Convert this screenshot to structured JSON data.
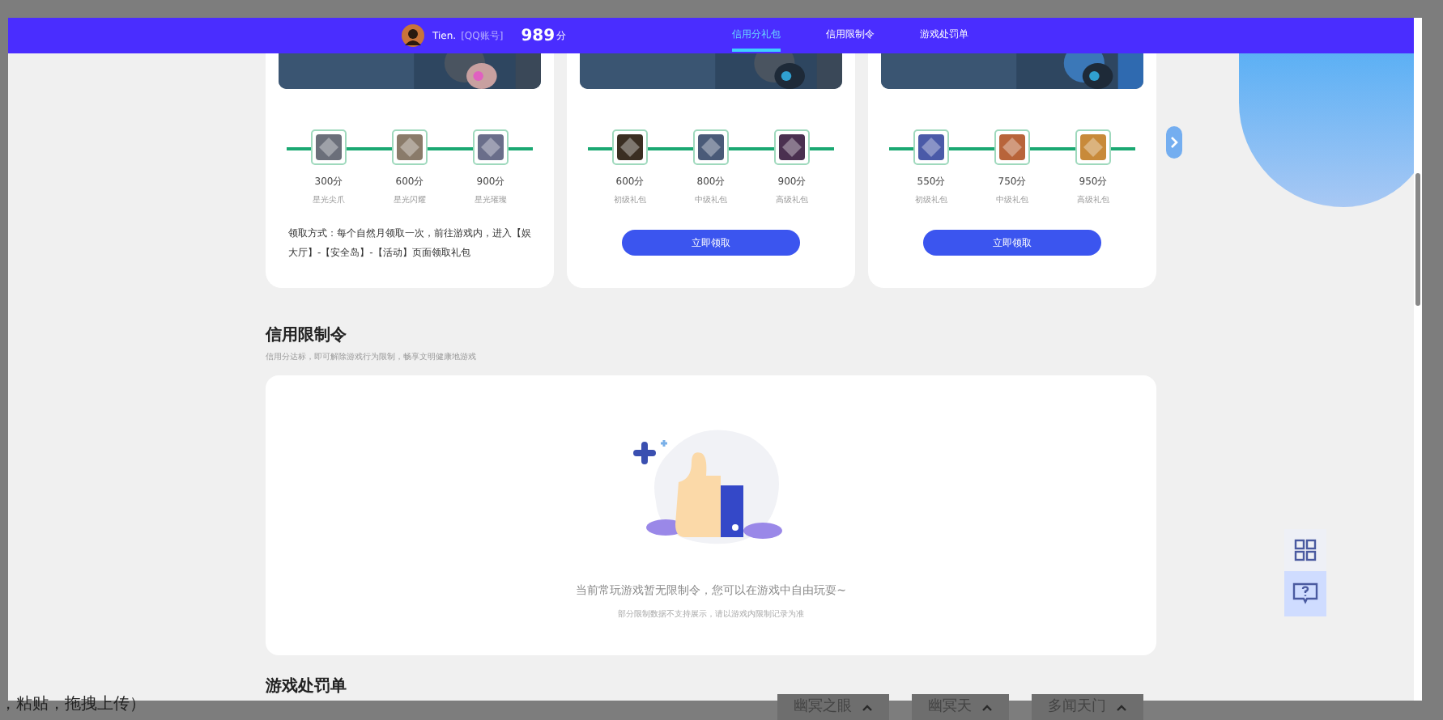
{
  "nav": {
    "user": {
      "name": "Tien.",
      "account": "[QQ账号]",
      "score": "989",
      "score_unit": "分"
    },
    "tabs": [
      {
        "label": "信用分礼包",
        "selected": true
      },
      {
        "label": "信用限制令",
        "selected": false
      },
      {
        "label": "游戏处罚单",
        "selected": false
      }
    ]
  },
  "gift_cards": [
    {
      "kind": "note",
      "rewards": [
        {
          "points": "300分",
          "name": "星光尖爪"
        },
        {
          "points": "600分",
          "name": "星光闪耀"
        },
        {
          "points": "900分",
          "name": "星光璀璨"
        }
      ],
      "note": "领取方式：每个自然月领取一次，前往游戏内，进入【娱大厅】-【安全岛】-【活动】页面领取礼包"
    },
    {
      "kind": "button",
      "rewards": [
        {
          "points": "600分",
          "name": "初级礼包"
        },
        {
          "points": "800分",
          "name": "中级礼包"
        },
        {
          "points": "900分",
          "name": "高级礼包"
        }
      ],
      "button": "立即领取"
    },
    {
      "kind": "button",
      "rewards": [
        {
          "points": "550分",
          "name": "初级礼包"
        },
        {
          "points": "750分",
          "name": "中级礼包"
        },
        {
          "points": "950分",
          "name": "高级礼包"
        }
      ],
      "button": "立即领取"
    }
  ],
  "restriction": {
    "title": "信用限制令",
    "subtitle": "信用分达标，即可解除游戏行为限制，畅享文明健康地游戏",
    "empty_message": "当前常玩游戏暂无限制令，您可以在游戏中自由玩耍~",
    "empty_hint": "部分限制数据不支持展示，请以游戏内限制记录为准"
  },
  "penalty": {
    "title": "游戏处罚单"
  },
  "background_page": {
    "text": "，粘贴，拖拽上传）",
    "tags": [
      "幽冥之眼",
      "幽冥天",
      "多闻天门"
    ]
  }
}
